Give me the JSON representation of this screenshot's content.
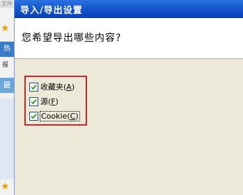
{
  "background": {
    "menu_text": "文件",
    "item_1": "热",
    "item_2": "报",
    "item_3": "最"
  },
  "dialog": {
    "title": "导入/导出设置",
    "question": "您希望导出哪些内容?",
    "options": [
      {
        "label": "收藏夹",
        "hotkey": "A",
        "checked": true
      },
      {
        "label": "源",
        "hotkey": "F",
        "checked": true
      },
      {
        "label": "Cookie",
        "hotkey": "C",
        "checked": true
      }
    ]
  },
  "colors": {
    "title_bar": "#1150c8",
    "highlight_border": "#c62828",
    "check_mark": "#21a121"
  }
}
